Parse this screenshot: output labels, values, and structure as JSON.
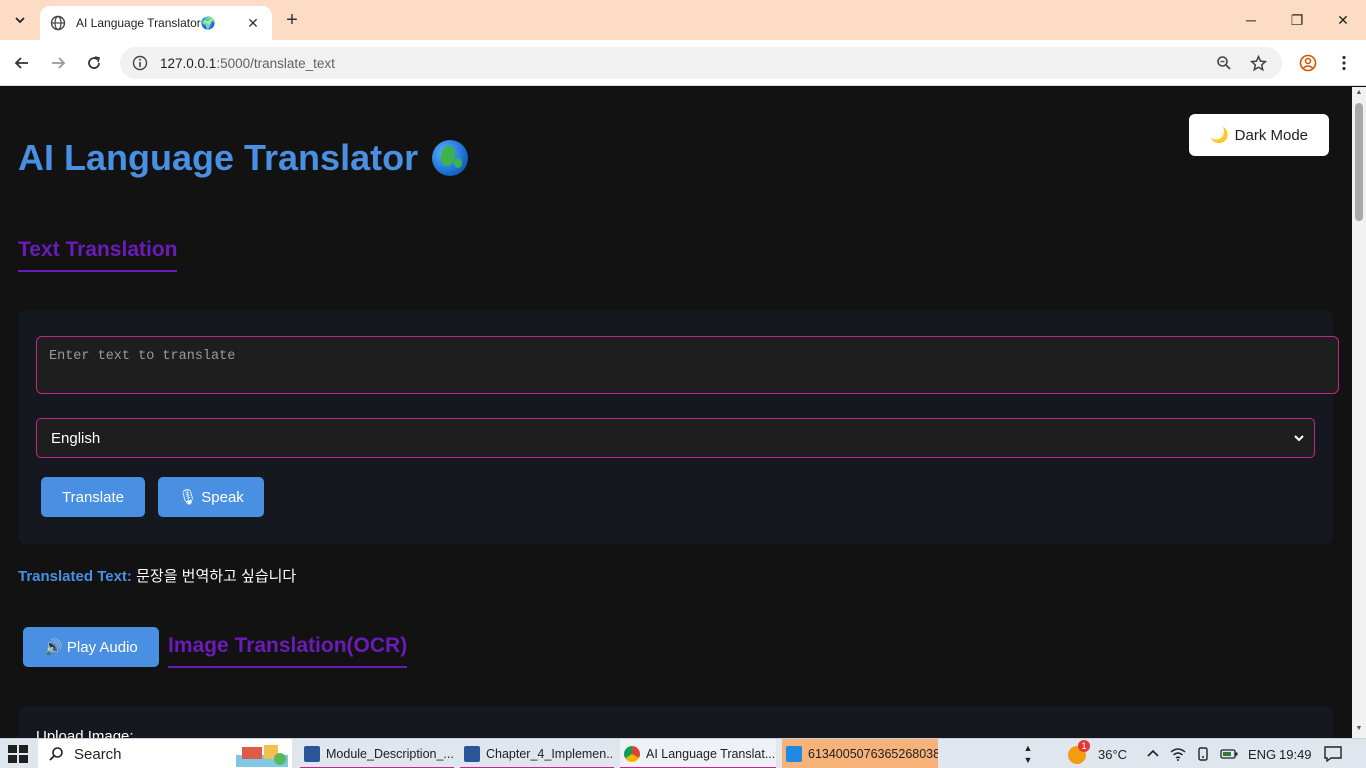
{
  "browser": {
    "tab_title": "AI Language Translator",
    "tab_title_suffix": "🌍",
    "url_host": "127.0.0.1",
    "url_path": ":5000/translate_text",
    "controls": {
      "minimize": "─",
      "maximize": "❐",
      "close": "✕"
    }
  },
  "header": {
    "dark_mode_label": "Dark Mode",
    "dark_mode_icon": "🌙",
    "title": "AI Language Translator"
  },
  "text_section": {
    "heading": "Text Translation",
    "input_placeholder": "Enter text to translate",
    "selected_language": "English",
    "translate_label": "Translate",
    "speak_label": "Speak",
    "speak_icon": "🎙"
  },
  "result": {
    "label": "Translated Text:",
    "value": "문장을 번역하고 싶습니다"
  },
  "audio": {
    "play_label": "Play Audio",
    "play_icon": "🔊"
  },
  "image_section": {
    "heading": "Image Translation(OCR)",
    "upload_label": "Upload Image:"
  },
  "taskbar": {
    "search_label": "Search",
    "items": [
      {
        "label": "Module_Description_...",
        "color": "#2b579a"
      },
      {
        "label": "Chapter_4_Implemen...",
        "color": "#2b579a"
      },
      {
        "label": "AI Language Translat...",
        "color": "#4285f4"
      },
      {
        "label": "6134005076365268038...",
        "color": "#1e88e5"
      }
    ],
    "weather_badge": "1",
    "temperature": "36°C",
    "language": "ENG",
    "time": "19:49"
  }
}
